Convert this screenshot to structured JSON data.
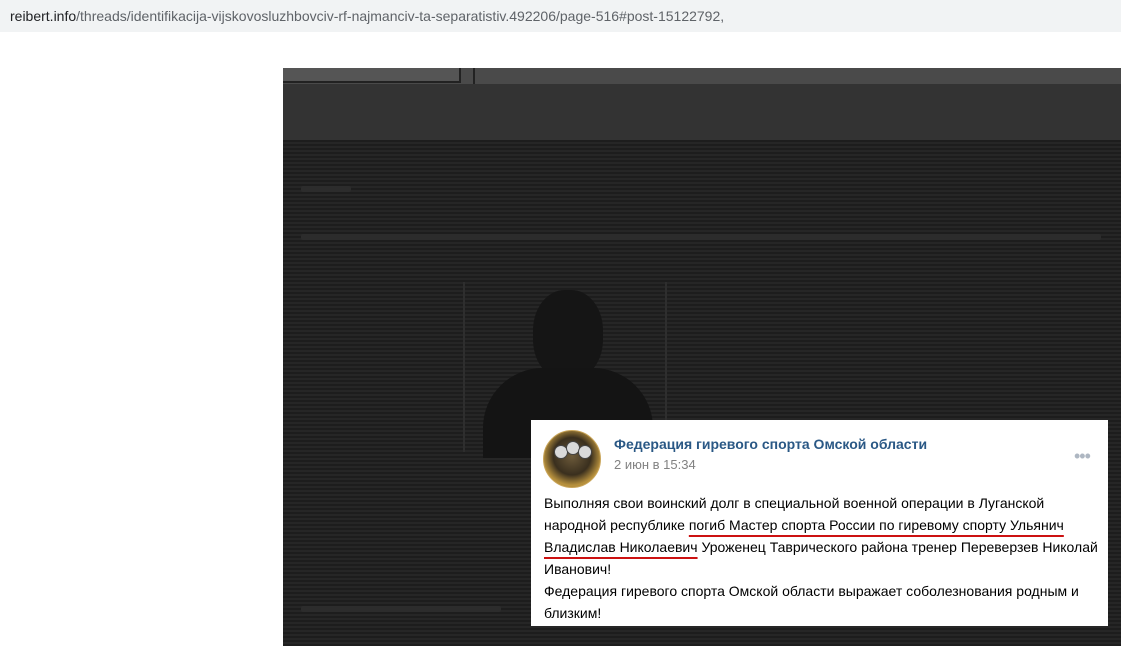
{
  "browser": {
    "url_host": "reibert.info",
    "url_path": "/threads/identifikacija-vijskovosluzhbovciv-rf-najmanciv-ta-separatistiv.492206/page-516#post-15122792,"
  },
  "post": {
    "group_name": "Федерация гиревого спорта Омской области",
    "time": "2 июн в 15:34",
    "menu_icon": "more-dots-icon",
    "text": {
      "part1": "Выполняя свои воинский долг в специальной военной операции в Луганской народной республике ",
      "underlined1": "погиб Мастер спорта России по гиревому спорту Ульянич",
      "underlined2": "Владислав Николаевич",
      "part2": " Уроженец Таврического района тренер Переверзев Николай Иванович!",
      "paragraph2": "Федерация гиревого спорта Омской области выражает соболезнования родным и близким!"
    },
    "underline_color": "#cc1111"
  }
}
